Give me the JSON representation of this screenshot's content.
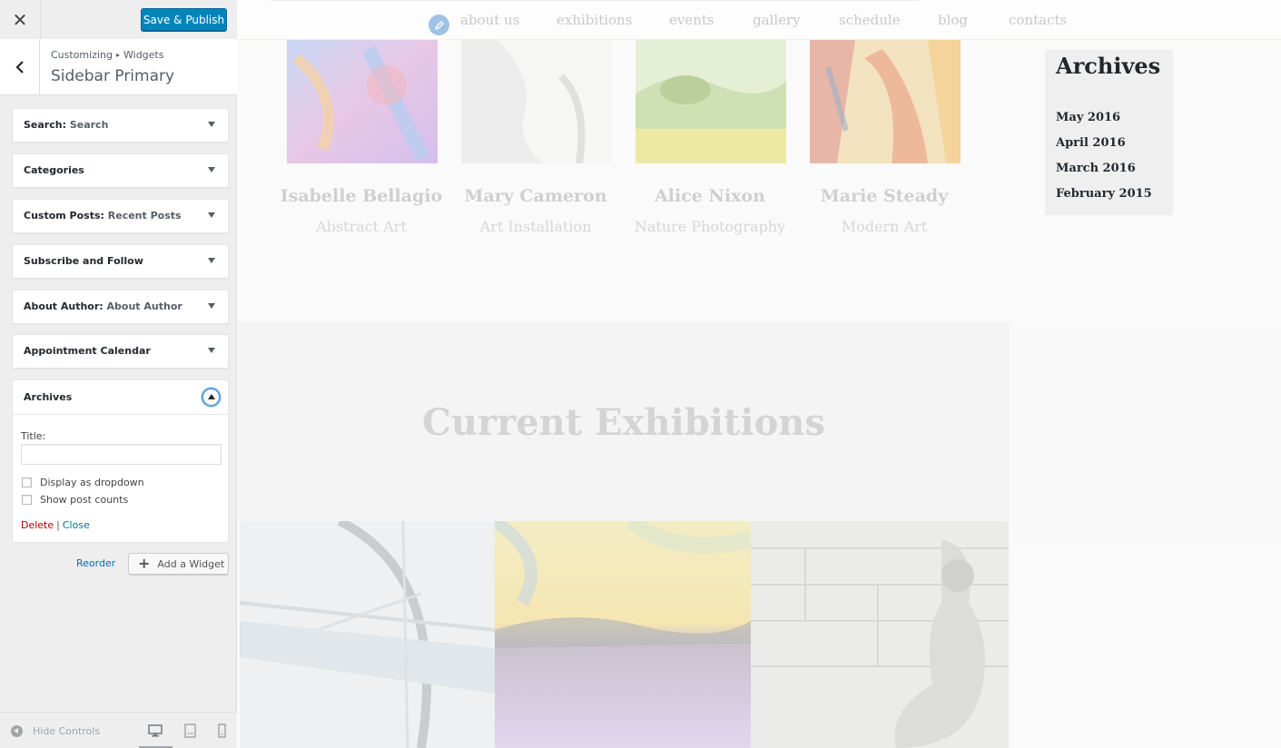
{
  "customizer": {
    "close_glyph": "✕",
    "save_label": "Save & Publish",
    "breadcrumb": {
      "root": "Customizing",
      "sep": "▸",
      "section": "Widgets"
    },
    "section_title": "Sidebar Primary",
    "widgets": [
      {
        "title": "Search",
        "instance": "Search"
      },
      {
        "title": "Categories",
        "instance": ""
      },
      {
        "title": "Custom Posts",
        "instance": "Recent Posts"
      },
      {
        "title": "Subscribe and Follow",
        "instance": ""
      },
      {
        "title": "About Author",
        "instance": "About Author"
      },
      {
        "title": "Appointment Calendar",
        "instance": ""
      }
    ],
    "open_widget": {
      "title": "Archives",
      "field_label": "Title:",
      "field_value": "",
      "checkbox_dropdown": "Display as dropdown",
      "checkbox_counts": "Show post counts",
      "delete": "Delete",
      "separator": "|",
      "close": "Close"
    },
    "reorder": "Reorder",
    "add_widget": "Add a Widget",
    "hide_controls": "Hide Controls",
    "colors": {
      "primary": "#0085ba",
      "link": "#0073aa",
      "delete": "#aa0000"
    }
  },
  "preview": {
    "nav": [
      "about us",
      "exhibitions",
      "events",
      "gallery",
      "schedule",
      "blog",
      "contacts"
    ],
    "artists": [
      {
        "name": "Isabelle Bellagio",
        "type": "Abstract Art"
      },
      {
        "name": "Mary Cameron",
        "type": "Art Installation"
      },
      {
        "name": "Alice Nixon",
        "type": "Nature Photography"
      },
      {
        "name": "Marie Steady",
        "type": "Modern Art"
      }
    ],
    "sidebar": {
      "title": "Archives",
      "links": [
        "May 2016",
        "April 2016",
        "March 2016",
        "February 2015"
      ]
    },
    "section_heading": "Current Exhibitions"
  }
}
